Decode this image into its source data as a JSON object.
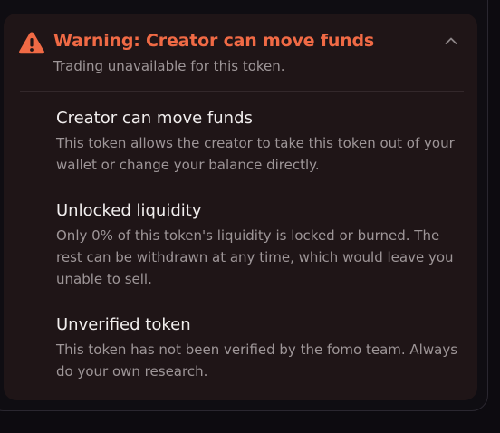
{
  "warning": {
    "title": "Warning: Creator can move funds",
    "subtitle": "Trading unavailable for this token.",
    "accent_color": "#f06a45",
    "icon": "warning-triangle-icon",
    "toggle_icon": "chevron-up-icon"
  },
  "risks": [
    {
      "title": "Creator can move funds",
      "description": "This token allows the creator to take this token out of your wallet or change your balance directly."
    },
    {
      "title": "Unlocked liquidity",
      "description": "Only 0% of this token's liquidity is locked or burned. The rest can be withdrawn at any time, which would leave you unable to sell."
    },
    {
      "title": "Unverified token",
      "description": "This token has not been verified by the fomo team. Always do your own research."
    }
  ]
}
